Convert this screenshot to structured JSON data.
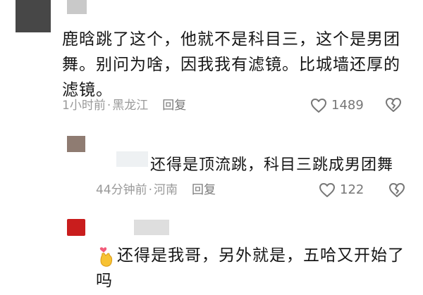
{
  "comments": [
    {
      "text": "鹿晗跳了这个，他就不是科目三，这个是男团舞。别问为啥，因我我有滤镜。比城墙还厚的滤镜。",
      "time": "1小时前",
      "location": "黑龙江",
      "reply_label": "回复",
      "likes": "1489"
    },
    {
      "text": "还得是顶流跳，科目三跳成男团舞",
      "time": "44分钟前",
      "location": "河南",
      "reply_label": "回复",
      "likes": "122"
    },
    {
      "text_line1": "还得是我哥，另外就是，五哈又开始了",
      "text_line2": "吗"
    }
  ],
  "icons": {
    "like": "heart-outline-icon",
    "dislike": "broken-heart-icon",
    "emoji": "finger-heart-emoji"
  },
  "colors": {
    "meta": "#999999",
    "text": "#161616",
    "avatar_red": "#c91d1d"
  }
}
